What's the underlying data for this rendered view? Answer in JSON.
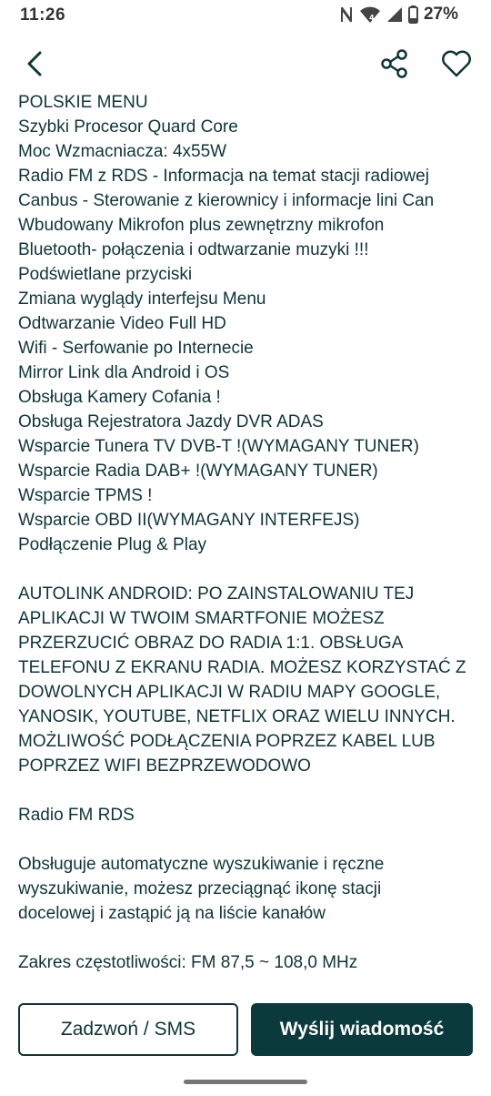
{
  "status_bar": {
    "time": "11:26",
    "battery": "27%"
  },
  "nav": {
    "back_icon": "chevron-left-icon",
    "share_icon": "share-icon",
    "favorite_icon": "heart-outline-icon"
  },
  "description": {
    "lines": [
      "POLSKIE MENU",
      "Szybki Procesor Quard Core",
      "Moc Wzmacniacza: 4x55W",
      "Radio FM z RDS - Informacja na temat stacji radiowej",
      "Canbus - Sterowanie z kierownicy i informacje lini Can",
      "Wbudowany Mikrofon plus zewnętrzny mikrofon",
      "Bluetooth- połączenia i odtwarzanie muzyki !!!",
      "Podświetlane przyciski",
      "Zmiana wyglądy interfejsu Menu",
      "Odtwarzanie Video Full HD",
      "Wifi - Serfowanie po Internecie",
      "Mirror Link dla Android i OS",
      "Obsługa Kamery Cofania !",
      "Obsługa Rejestratora Jazdy DVR ADAS",
      "Wsparcie Tunera TV DVB-T !(WYMAGANY TUNER)",
      "Wsparcie Radia DAB+ !(WYMAGANY TUNER)",
      "Wsparcie TPMS !",
      "Wsparcie OBD II(WYMAGANY INTERFEJS)",
      "Podłączenie Plug & Play",
      "",
      "AUTOLINK ANDROID: PO ZAINSTALOWANIU TEJ",
      "APLIKACJI W TWOIM SMARTFONIE MOŻESZ",
      "PRZERZUCIĆ OBRAZ DO RADIA 1:1. OBSŁUGA",
      "TELEFONU Z EKRANU RADIA. MOŻESZ KORZYSTAĆ Z",
      "DOWOLNYCH APLIKACJI W RADIU MAPY GOOGLE,",
      "YANOSIK, YOUTUBE, NETFLIX ORAZ WIELU INNYCH.",
      "MOŻLIWOŚĆ PODŁĄCZENIA POPRZEZ KABEL LUB",
      "POPRZEZ WIFI BEZPRZEWODOWO",
      "",
      "Radio FM RDS",
      "",
      "Obsługuje automatyczne wyszukiwanie i ręczne",
      "wyszukiwanie, możesz przeciągnąć ikonę stacji",
      "docelowej i zastąpić ją na liście kanałów",
      "",
      "Zakres częstotliwości: FM 87,5 ~ 108,0 MHz"
    ]
  },
  "actions": {
    "call_label": "Zadzwoń / SMS",
    "message_label": "Wyślij wiadomość"
  },
  "colors": {
    "text": "#0f3537",
    "primary": "#0b3a3c",
    "background": "#ffffff"
  }
}
